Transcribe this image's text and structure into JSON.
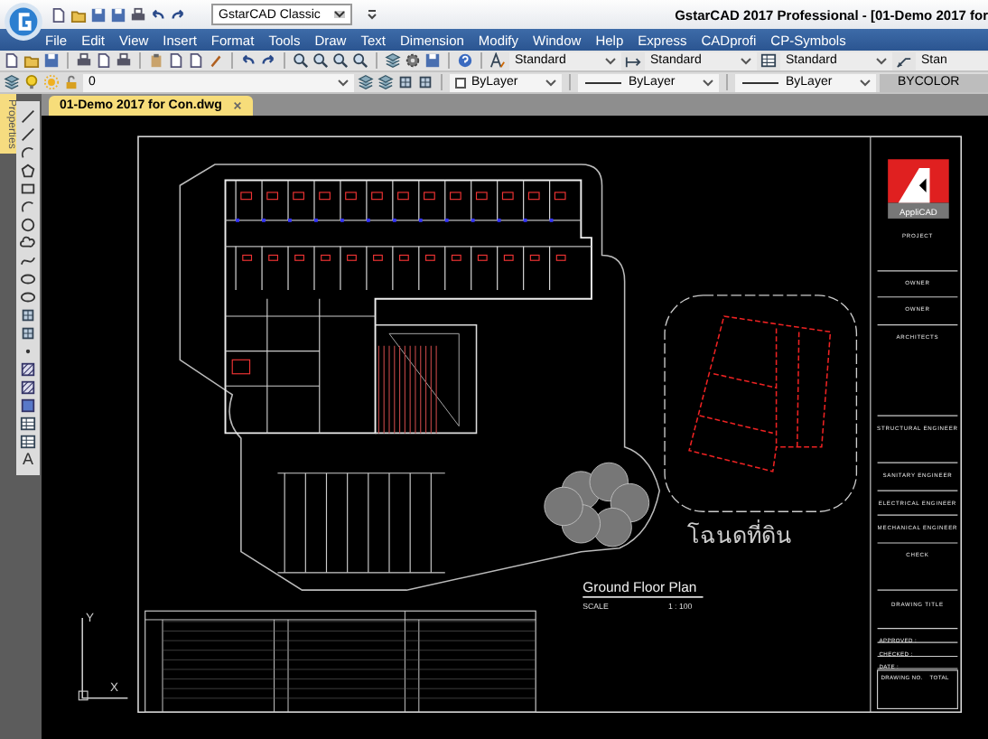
{
  "title_bar": {
    "workspace": "GstarCAD Classic",
    "title": "GstarCAD 2017 Professional - [01-Demo 2017 for"
  },
  "menu": [
    "File",
    "Edit",
    "View",
    "Insert",
    "Format",
    "Tools",
    "Draw",
    "Text",
    "Dimension",
    "Modify",
    "Window",
    "Help",
    "Express",
    "CADprofi",
    "CP-Symbols"
  ],
  "styles_toolbar": {
    "text_style": "Standard",
    "dimension_style": "Standard",
    "table_style": "Standard",
    "multileader_style": "Stan"
  },
  "properties_toolbar": {
    "layer": "0",
    "object_color": "ByLayer",
    "linetype": "ByLayer",
    "lineweight": "ByLayer",
    "plot_style": "BYCOLOR"
  },
  "tabs": [
    {
      "label": "01-Demo 2017 for Con.dwg",
      "selected": true
    }
  ],
  "side_panel": {
    "label": "Properties"
  },
  "draw_toolbar": {
    "text_tool": "A"
  },
  "drawing": {
    "plan_title": "Ground Floor Plan",
    "scale_label": "SCALE",
    "scale": "1 : 100",
    "land_label": "โฉนดที่ดิน",
    "ucs_y": "Y",
    "ucs_x": "X",
    "logo": "AppliCAD",
    "title_block": [
      "PROJECT",
      "OWNER",
      "OWNER",
      "ARCHITECTS",
      "STRUCTURAL ENGINEER",
      "SANITARY ENGINEER",
      "ELECTRICAL ENGINEER",
      "MECHANICAL ENGINEER",
      "CHECK",
      "DRAWING TITLE",
      "APPROVED :",
      "CHECKED :",
      "DATE :"
    ],
    "drawing_no_label": "DRAWING NO.",
    "total_label": "TOTAL"
  }
}
